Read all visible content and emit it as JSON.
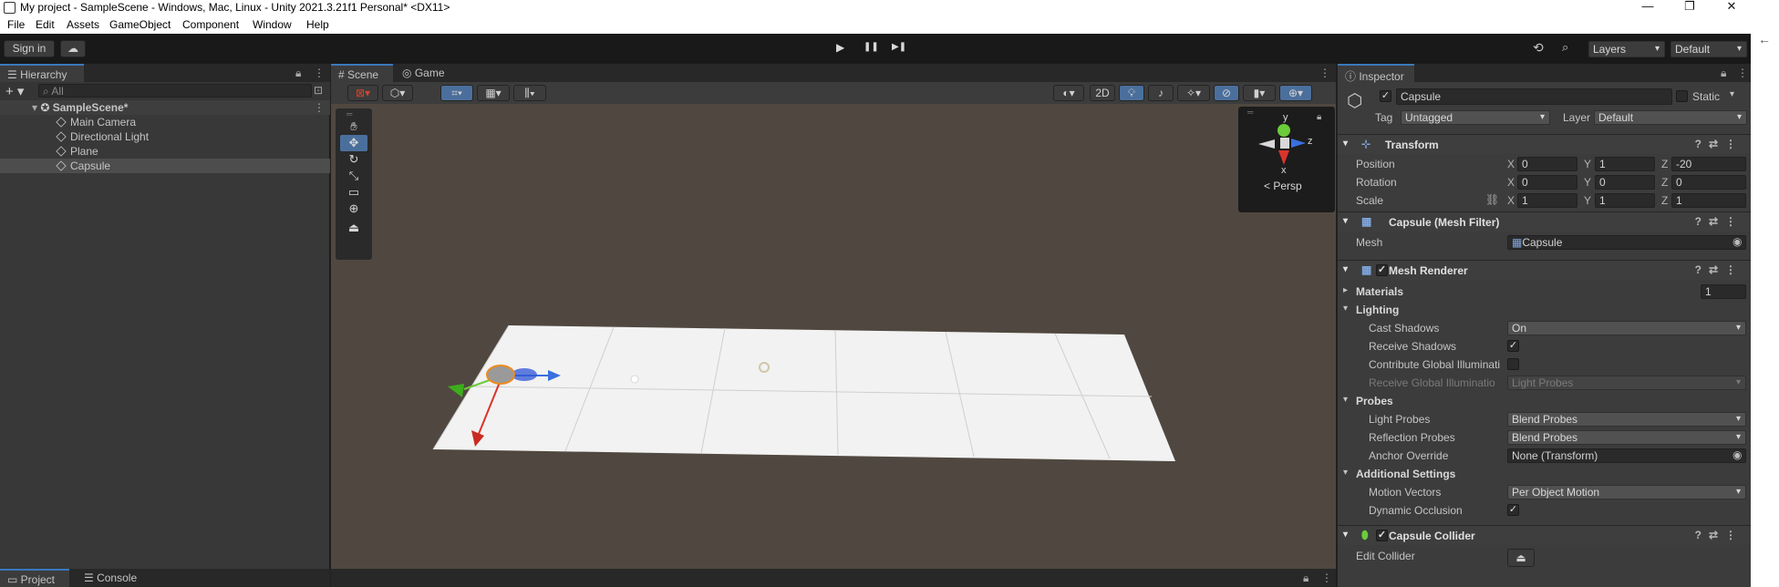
{
  "window": {
    "title": "My project - SampleScene - Windows, Mac, Linux - Unity 2021.3.21f1 Personal* <DX11>",
    "controls": [
      "—",
      "❐",
      "✕"
    ]
  },
  "menu": [
    "File",
    "Edit",
    "Assets",
    "GameObject",
    "Component",
    "Window",
    "Help"
  ],
  "toolbar": {
    "sign_in": "Sign in",
    "cloud_icon": "cloud-icon",
    "play_icon": "▶",
    "pause_icon": "❚❚",
    "step_icon": "▶❚",
    "history_icon": "history-icon",
    "search_icon": "search-icon",
    "layers": "Layers",
    "layout": "Default"
  },
  "hierarchy": {
    "tab": "Hierarchy",
    "search_placeholder": "All",
    "add_label": "+",
    "scene": "SampleScene*",
    "items": [
      "Main Camera",
      "Directional Light",
      "Plane",
      "Capsule"
    ],
    "selected": "Capsule"
  },
  "scene_view": {
    "tabs": [
      "Scene",
      "Game"
    ],
    "active_tab": "Scene",
    "toggle_2d": "2D",
    "gizmo": {
      "y": "y",
      "x": "x",
      "z": "z",
      "persp": "< Persp"
    }
  },
  "inspector": {
    "tab": "Inspector",
    "object_name": "Capsule",
    "static_label": "Static",
    "tag_label": "Tag",
    "tag_value": "Untagged",
    "layer_label": "Layer",
    "layer_value": "Default",
    "transform": {
      "title": "Transform",
      "position_label": "Position",
      "rotation_label": "Rotation",
      "scale_label": "Scale",
      "position": {
        "x": "0",
        "y": "1",
        "z": "-20"
      },
      "rotation": {
        "x": "0",
        "y": "0",
        "z": "0"
      },
      "scale": {
        "x": "1",
        "y": "1",
        "z": "1"
      }
    },
    "mesh_filter": {
      "title": "Capsule (Mesh Filter)",
      "mesh_label": "Mesh",
      "mesh_value": "Capsule"
    },
    "mesh_renderer": {
      "title": "Mesh Renderer",
      "materials_label": "Materials",
      "materials_count": "1",
      "lighting": "Lighting",
      "cast_shadows_label": "Cast Shadows",
      "cast_shadows": "On",
      "receive_shadows_label": "Receive Shadows",
      "contribute_gi_label": "Contribute Global Illuminati",
      "receive_gi_label": "Receive Global Illuminatio",
      "receive_gi": "Light Probes",
      "probes": "Probes",
      "light_probes_label": "Light Probes",
      "light_probes": "Blend Probes",
      "reflection_probes_label": "Reflection Probes",
      "reflection_probes": "Blend Probes",
      "anchor_override_label": "Anchor Override",
      "anchor_override": "None (Transform)",
      "additional": "Additional Settings",
      "motion_vectors_label": "Motion Vectors",
      "motion_vectors": "Per Object Motion",
      "dynamic_occlusion_label": "Dynamic Occlusion"
    },
    "capsule_collider": {
      "title": "Capsule Collider",
      "edit_label": "Edit Collider"
    }
  },
  "bottom": {
    "project": "Project",
    "console": "Console"
  },
  "colors": {
    "accent": "#3a79bb",
    "x_axis": "#d9342b",
    "y_axis": "#6bcb3a",
    "z_axis": "#3a6fe0"
  }
}
